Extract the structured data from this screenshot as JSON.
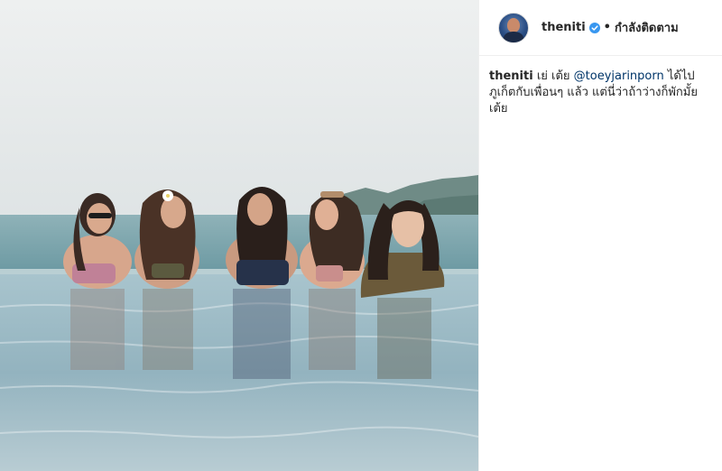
{
  "post": {
    "username": "theniti",
    "verified": true,
    "separator": "•",
    "follow_status": "กำลังติดตาม",
    "caption": {
      "username": "theniti",
      "text_before": "เย่ เต้ย",
      "mention": "@toeyjarinporn",
      "text_after": "ได้ไปภูเก็ตกับเพื่อนๆ แล้ว แต่นี่ว่าถ้าว่างก็พักมั้ยเต้ย"
    }
  },
  "colors": {
    "verified_badge": "#3897f0",
    "mention": "#003569",
    "text": "#262626"
  }
}
